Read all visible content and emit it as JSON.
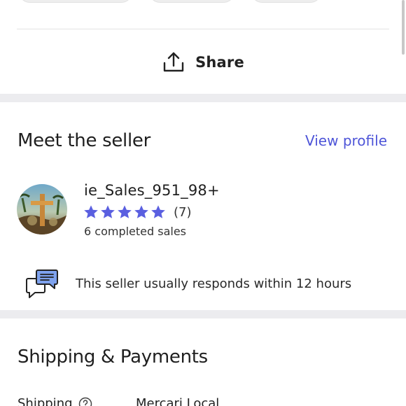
{
  "share": {
    "label": "Share",
    "icon": "share-upload-icon"
  },
  "seller_section": {
    "title": "Meet the seller",
    "view_profile_label": "View profile",
    "seller_name": "ie_Sales_951_98+",
    "rating_stars": 5,
    "review_count": "(7)",
    "completed_sales": "6 completed sales",
    "response_time": "This seller usually responds within 12 hours"
  },
  "shipping_section": {
    "title": "Shipping & Payments",
    "shipping_label": "Shipping",
    "shipping_value": "Mercari Local"
  },
  "colors": {
    "accent": "#4e55d8",
    "star": "#5a5fe0",
    "divider_band": "#ececef"
  }
}
